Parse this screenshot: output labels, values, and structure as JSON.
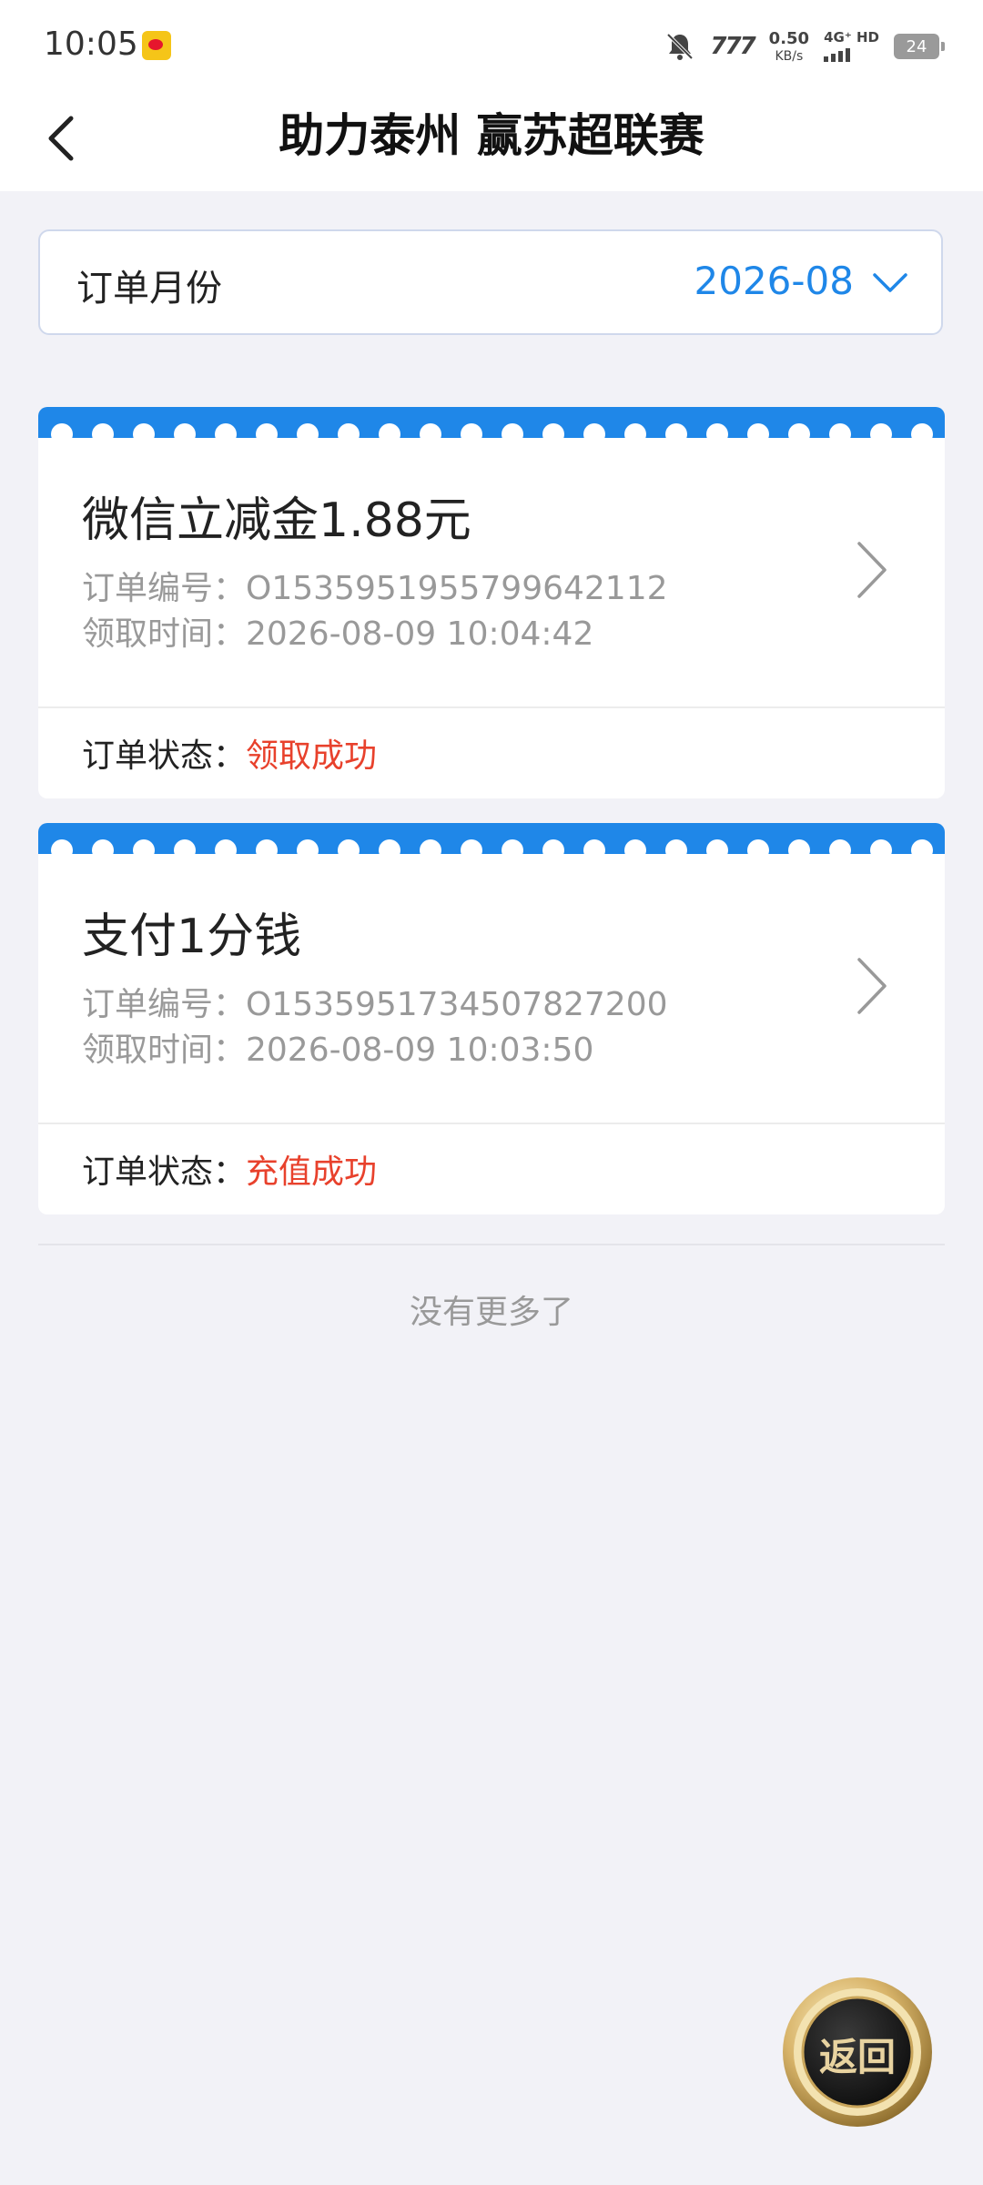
{
  "status_bar": {
    "time": "10:05",
    "signal_text": "777",
    "net_speed_value": "0.50",
    "net_speed_unit": "KB/s",
    "net_type": "4G⁺ HD",
    "battery": "24"
  },
  "nav": {
    "title": "助力泰州 赢苏超联赛"
  },
  "filter": {
    "label": "订单月份",
    "value": "2026-08"
  },
  "orders": [
    {
      "title": "微信立减金1.88元",
      "order_line": "订单编号：O1535951955799642112",
      "time_line": "领取时间：2026-08-09 10:04:42",
      "status_label": "订单状态：",
      "status_value": "领取成功"
    },
    {
      "title": "支付1分钱",
      "order_line": "订单编号：O1535951734507827200",
      "time_line": "领取时间：2026-08-09 10:03:50",
      "status_label": "订单状态：",
      "status_value": "充值成功"
    }
  ],
  "list_end": "没有更多了",
  "float_button": {
    "label": "返回"
  },
  "colors": {
    "accent": "#1f87e8",
    "status": "#e8412c",
    "page_bg": "#f2f2f7"
  }
}
